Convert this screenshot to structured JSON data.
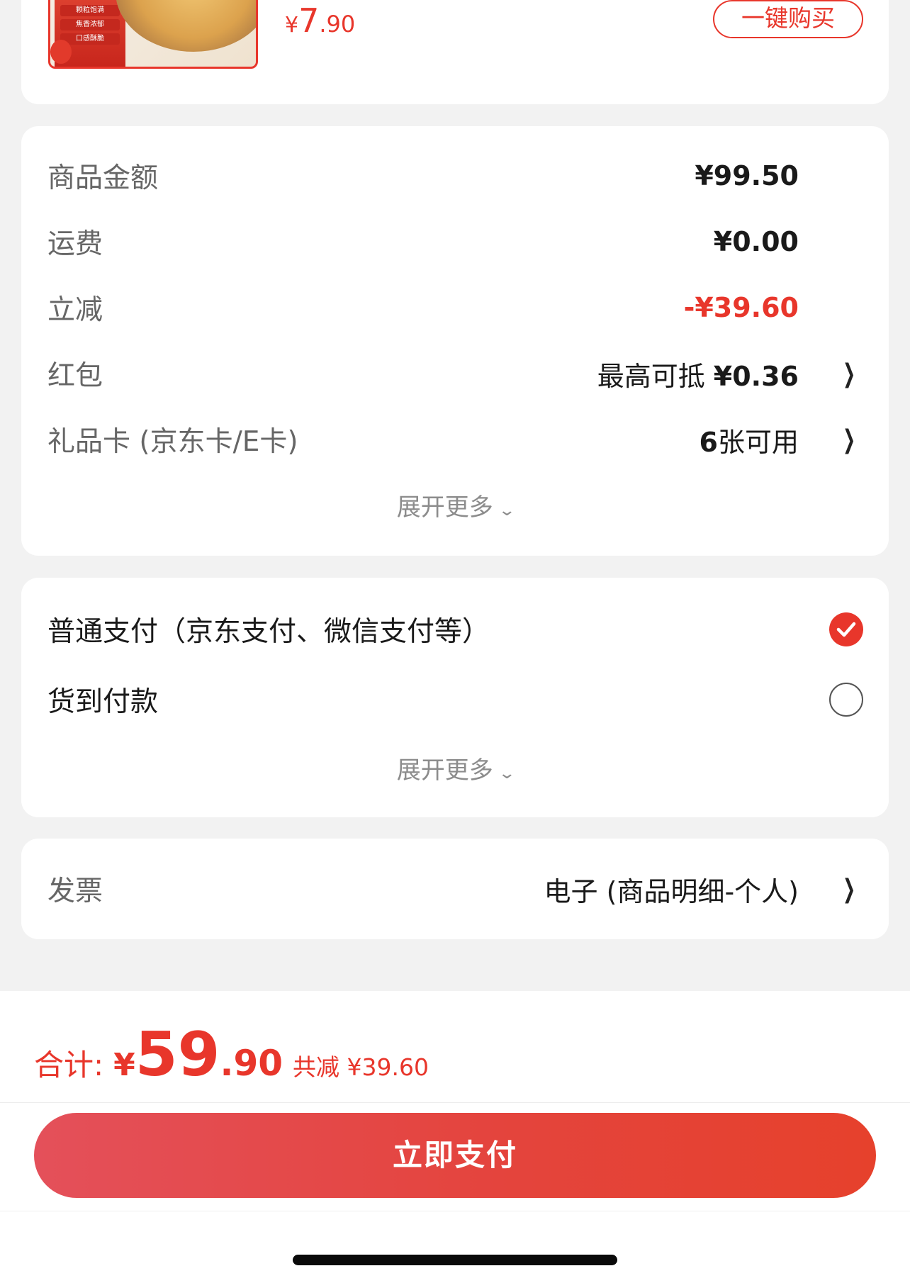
{
  "product": {
    "thumb_tags": [
      "颗粒饱满",
      "焦香浓郁",
      "口感酥脆"
    ],
    "price_symbol": "¥",
    "price_int": "7",
    "price_dec": ".90",
    "buy_label": "一键购买"
  },
  "summary": {
    "rows": [
      {
        "label": "商品金额",
        "value": "¥99.50"
      },
      {
        "label": "运费",
        "value": "¥0.00"
      },
      {
        "label": "立减",
        "value": "-¥39.60"
      },
      {
        "label": "红包",
        "value_text": "最高可抵 ",
        "value_amount": "¥0.36"
      },
      {
        "label": "礼品卡 (京东卡/E卡)",
        "value_amount": "6",
        "value_text": "张可用"
      }
    ],
    "expand_label": "展开更多"
  },
  "payment": {
    "options": [
      {
        "label": "普通支付（京东支付、微信支付等）",
        "selected": true
      },
      {
        "label": "货到付款",
        "selected": false
      }
    ],
    "expand_label": "展开更多"
  },
  "invoice": {
    "label": "发票",
    "value": "电子 (商品明细-个人)"
  },
  "footer": {
    "total_label": "合计:",
    "total_symbol": "¥",
    "total_int": "59",
    "total_dec": ".90",
    "savings": "共减 ¥39.60",
    "pay_button": "立即支付"
  },
  "colors": {
    "accent": "#e8362b",
    "background": "#f2f2f2",
    "card": "#ffffff",
    "label_gray": "#666666"
  }
}
